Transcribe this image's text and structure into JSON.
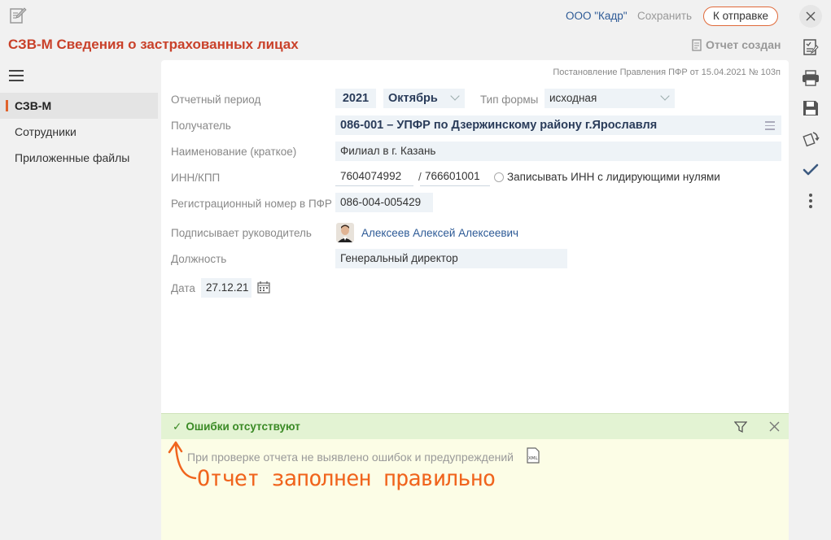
{
  "header": {
    "org_name": "ООО \"Кадр\"",
    "save_label": "Сохранить",
    "send_label": "К отправке",
    "title": "СЗВ-М Сведения о застрахованных лицах",
    "report_status": "Отчет создан"
  },
  "nav": {
    "items": [
      {
        "label": "СЗВ-М",
        "active": true
      },
      {
        "label": "Сотрудники",
        "active": false
      },
      {
        "label": "Приложенные файлы",
        "active": false
      }
    ]
  },
  "form": {
    "decree": "Постановление Правления ПФР от 15.04.2021 № 103п",
    "period_label": "Отчетный период",
    "period_year": "2021",
    "period_month": "Октябрь",
    "form_type_label": "Тип формы",
    "form_type_value": "исходная",
    "recipient_label": "Получатель",
    "recipient_value": "086-001 – УПФР по Дзержинскому району г.Ярославля",
    "name_label": "Наименование (краткое)",
    "name_value": "Филиал в г. Казань",
    "inn_kpp_label": "ИНН/КПП",
    "inn_value": "7604074992",
    "kpp_separator": "/",
    "kpp_value": "766601001",
    "leading_zeros_label": "Записывать ИНН с лидирующими нулями",
    "reg_number_label": "Регистрационный номер в ПФР",
    "reg_number_value": "086-004-005429",
    "signer_label": "Подписывает руководитель",
    "signer_value": "Алексеев Алексей Алексеевич",
    "position_label": "Должность",
    "position_value": "Генеральный директор",
    "date_label": "Дата",
    "date_value": "27.12.21"
  },
  "validation": {
    "status": "Ошибки отсутствуют",
    "message": "При проверке отчета не выявлено ошибок и предупреждений",
    "xml_label": "XML",
    "annotation": "Отчет заполнен правильно"
  },
  "colors": {
    "accent": "#c9412a",
    "link": "#2d5a96",
    "success": "#3a8a25",
    "annotation": "#f0641d"
  },
  "toolbar_icons": [
    "close-icon",
    "checklist-icon",
    "print-icon",
    "save-icon",
    "sync-icon",
    "checkmark-icon",
    "more-icon"
  ]
}
